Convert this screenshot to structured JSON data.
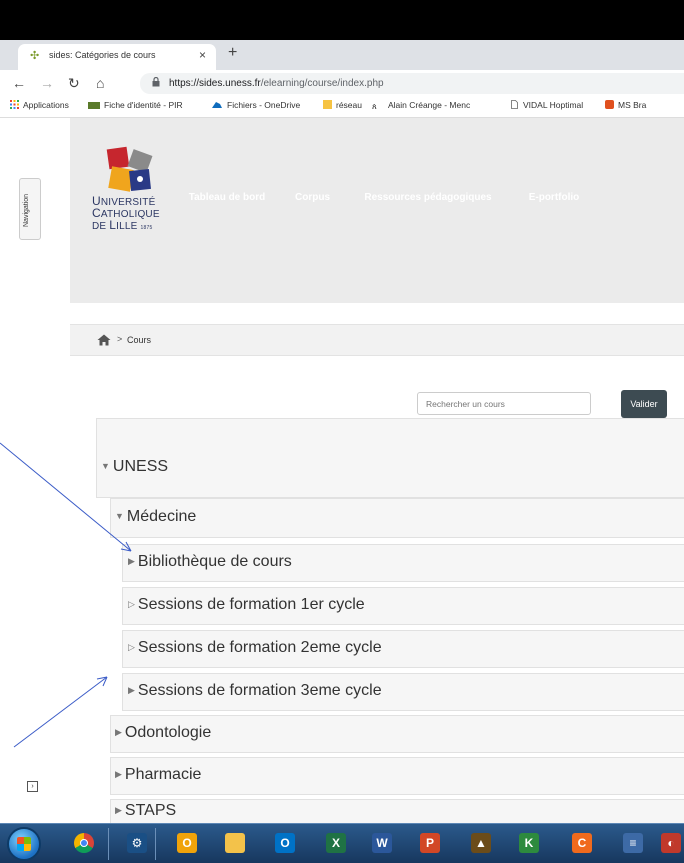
{
  "browser": {
    "tab_title": "sides: Catégories de cours",
    "tab_close": "×",
    "new_tab": "+",
    "url_host": "https://sides.uness.fr",
    "url_path": "/elearning/course/index.php"
  },
  "bookmarks": [
    {
      "label": "Applications",
      "icon": "apps-grid-icon",
      "color": "#ea4335"
    },
    {
      "label": "Fiche d'identité - PIR",
      "icon": "bookmark-pir-icon",
      "color": "#5a7a2a"
    },
    {
      "label": "Fichiers - OneDrive",
      "icon": "onedrive-icon",
      "color": "#0f6cbd"
    },
    {
      "label": "réseau",
      "icon": "folder-icon",
      "color": "#f6c342"
    },
    {
      "label": "Alain Créange - Menc",
      "icon": "bookmark-people-icon",
      "color": "#333333"
    },
    {
      "label": "VIDAL Hoptimal",
      "icon": "page-icon",
      "color": "#666666"
    },
    {
      "label": "MS Bra",
      "icon": "bookmark-ms-icon",
      "color": "#e0501e"
    }
  ],
  "page": {
    "nav_drawer_label": "Navigation",
    "logo": {
      "line1_cap": "U",
      "line1": "NIVERSITÉ",
      "line2_cap": "C",
      "line2": "ATHOLIQUE",
      "line3": "DE",
      "line3_cap": "L",
      "line3_rest": "ILLE",
      "year": "1875"
    },
    "nav_buttons": [
      {
        "label": "Tableau de bord",
        "color": "#2d2a6e"
      },
      {
        "label": "Corpus",
        "color": "#23415a"
      },
      {
        "label": "Ressources pédagogiques",
        "color": "#f48a2a"
      },
      {
        "label": "E-portfolio",
        "color": "#e8a41f"
      }
    ],
    "breadcrumb": {
      "home": "home-icon",
      "separator": ">",
      "current": "Cours"
    },
    "search": {
      "placeholder": "Rechercher un cours",
      "button": "Valider"
    },
    "categories": [
      {
        "label": "UNESS",
        "state": "expanded"
      },
      {
        "label": "Médecine",
        "state": "expanded"
      },
      {
        "label": "Bibliothèque de cours",
        "state": "collapsed"
      },
      {
        "label": "Sessions de formation 1er cycle",
        "state": "collapsed-empty"
      },
      {
        "label": "Sessions de formation 2eme cycle",
        "state": "collapsed-empty"
      },
      {
        "label": "Sessions de formation 3eme cycle",
        "state": "collapsed"
      },
      {
        "label": "Odontologie",
        "state": "collapsed"
      },
      {
        "label": "Pharmacie",
        "state": "collapsed"
      },
      {
        "label": "STAPS",
        "state": "collapsed"
      }
    ],
    "sidebar_toggle": "›"
  },
  "taskbar": {
    "apps": [
      {
        "name": "chrome",
        "color": "#db4437",
        "glyph": ""
      },
      {
        "name": "network",
        "color": "#1a4f85",
        "glyph": "⚙"
      },
      {
        "name": "outlook",
        "color": "#f0a30a",
        "glyph": "O"
      },
      {
        "name": "explorer",
        "color": "#f3c24a",
        "glyph": ""
      },
      {
        "name": "outlook2",
        "color": "#0072c6",
        "glyph": "O"
      },
      {
        "name": "excel",
        "color": "#1f7244",
        "glyph": "X"
      },
      {
        "name": "word",
        "color": "#2b579a",
        "glyph": "W"
      },
      {
        "name": "powerpoint",
        "color": "#d24726",
        "glyph": "P"
      },
      {
        "name": "app-puzzle",
        "color": "#6b4c1a",
        "glyph": "▲"
      },
      {
        "name": "app-green",
        "color": "#2d8a3e",
        "glyph": "K"
      },
      {
        "name": "app-orange",
        "color": "#f06a1d",
        "glyph": "C"
      },
      {
        "name": "notes",
        "color": "#3d6aa6",
        "glyph": "≡"
      },
      {
        "name": "app-red",
        "color": "#c0392b",
        "glyph": "◐"
      }
    ]
  }
}
